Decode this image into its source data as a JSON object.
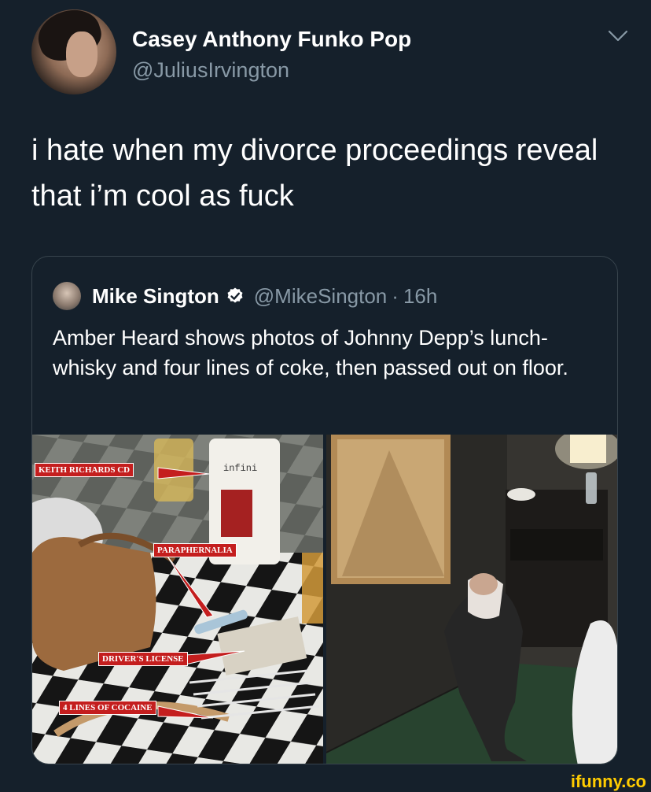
{
  "tweet": {
    "display_name": "Casey Anthony Funko Pop",
    "handle": "@JuliusIrvington",
    "text": "i hate when my divorce proceedings reveal that i’m cool as fuck"
  },
  "quoted_tweet": {
    "display_name": "Mike Sington",
    "handle": "@MikeSington",
    "separator": "·",
    "time": "16h",
    "text": "Amber Heard shows photos of Johnny Depp’s lunch- whisky and four lines of coke, then passed out on floor."
  },
  "photo_labels": {
    "keith": "KEITH RICHARDS CD",
    "paraphernalia": "PARAPHERNALIA",
    "license": "DRIVER'S LICENSE",
    "cocaine": "4 LINES OF COCAINE",
    "cup_text": "infini"
  },
  "watermark": "ifunny.co",
  "colors": {
    "background": "#15202b",
    "secondary_text": "#8899a6",
    "border": "#38444d",
    "verified_blue": "#ffffff",
    "label_red": "#c41e1e",
    "watermark": "#ffcc00"
  },
  "icons": [
    "chevron-down-icon",
    "verified-badge-icon"
  ]
}
